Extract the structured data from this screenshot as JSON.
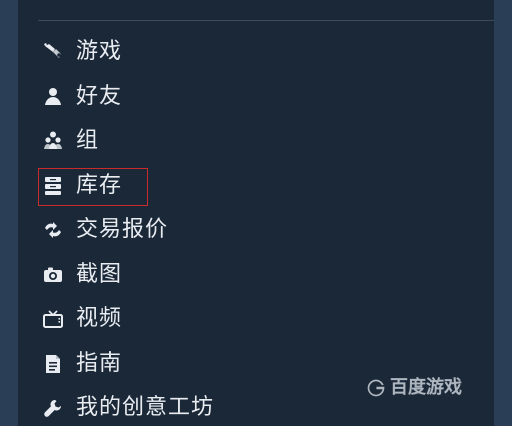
{
  "menu": {
    "items": [
      {
        "label": "游戏",
        "icon": "game-controller-icon"
      },
      {
        "label": "好友",
        "icon": "person-icon"
      },
      {
        "label": "组",
        "icon": "group-icon"
      },
      {
        "label": "库存",
        "icon": "inventory-icon"
      },
      {
        "label": "交易报价",
        "icon": "trade-arrows-icon"
      },
      {
        "label": "截图",
        "icon": "camera-icon"
      },
      {
        "label": "视频",
        "icon": "tv-icon"
      },
      {
        "label": "指南",
        "icon": "document-icon"
      },
      {
        "label": "我的创意工坊",
        "icon": "wrench-icon"
      }
    ],
    "highlighted_index": 3
  },
  "watermark": {
    "text": "百度游戏"
  },
  "colors": {
    "panel": "#1b2838",
    "text": "#e9edf1",
    "highlight_border": "#c92b2b",
    "divider": "#3f4b58"
  }
}
